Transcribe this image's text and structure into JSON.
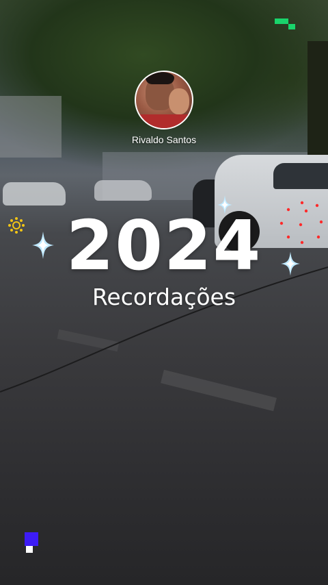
{
  "story": {
    "user_name": "Rivaldo Santos",
    "year": "2024",
    "subtitle": "Recordações"
  },
  "icons": {
    "avatar": "profile-photo",
    "sparkles": [
      "sparkle-icon",
      "sparkle-icon",
      "sparkle-icon"
    ],
    "sun": "sun-icon",
    "pixel_top_right": "green-pixel-icon",
    "pixel_bottom_left": "blue-pixel-icon"
  },
  "colors": {
    "text": "#ffffff",
    "green_pixel": "#19d46b",
    "blue_pixel": "#3d1cf5",
    "sparkle": "#bfe9ff",
    "sun": "#f2c516",
    "red_dots": "#ff2a2a"
  }
}
